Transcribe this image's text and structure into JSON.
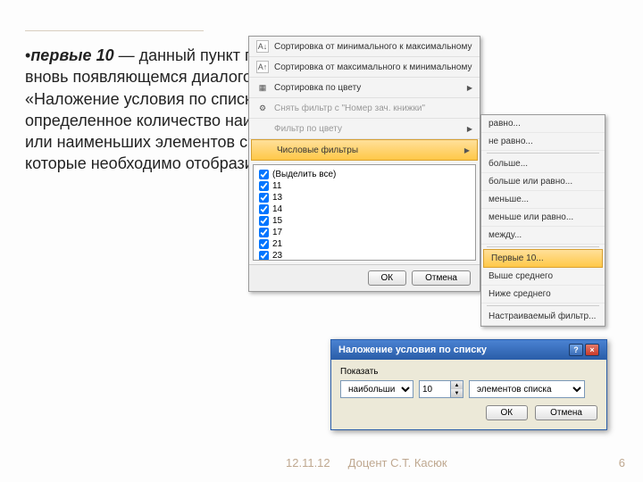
{
  "text": {
    "bullet_lead": "первые 10",
    "bullet_rest": " — данный пункт позволяет во вновь появляющемся диалоговом окне «Наложение условия по списку» выбрать определенное количество наибольших или наименьших элементов списка, которые необходимо отобразить;"
  },
  "filter_panel": {
    "sort_asc": "Сортировка от минимального к максимальному",
    "sort_desc": "Сортировка от максимального к минимальному",
    "sort_color": "Сортировка по цвету",
    "clear_filter": "Снять фильтр с \"Номер зач. книжки\"",
    "filter_color": "Фильтр по цвету",
    "num_filters": "Числовые фильтры",
    "select_all": "(Выделить все)",
    "values": [
      "11",
      "13",
      "14",
      "15",
      "17",
      "21",
      "23"
    ],
    "ok": "ОК",
    "cancel": "Отмена"
  },
  "submenu": {
    "items": [
      {
        "label": "равно...",
        "u": "р"
      },
      {
        "label": "не равно...",
        "u": "н"
      },
      {
        "label": "больше...",
        "u": "б"
      },
      {
        "label": "больше или равно...",
        "u": "б"
      },
      {
        "label": "меньше...",
        "u": "м"
      },
      {
        "label": "меньше или равно...",
        "u": "м"
      },
      {
        "label": "между...",
        "u": "м"
      },
      {
        "label": "Первые 10...",
        "u": "П",
        "hl": true
      },
      {
        "label": "Выше среднего",
        "u": "В"
      },
      {
        "label": "Ниже среднего",
        "u": "Н"
      },
      {
        "label": "Настраиваемый фильтр...",
        "u": "Н"
      }
    ]
  },
  "dialog": {
    "title": "Наложение условия по списку",
    "show": "Показать",
    "sel1": "наибольших",
    "spin": "10",
    "sel2": "элементов списка",
    "ok": "ОК",
    "cancel": "Отмена"
  },
  "footer": {
    "date": "12.11.12",
    "author": "Доцент С.Т. Касюк",
    "page": "6"
  }
}
